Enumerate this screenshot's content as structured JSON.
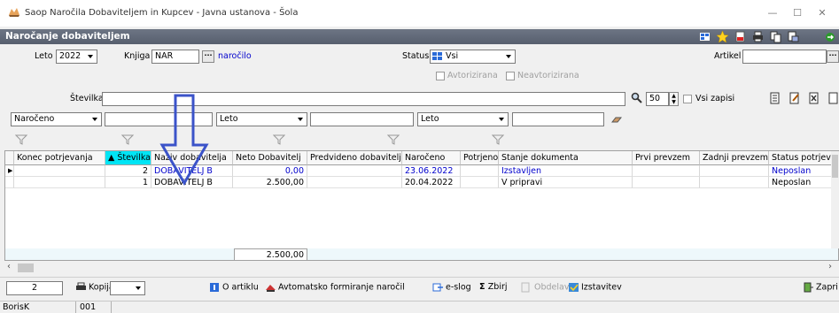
{
  "window": {
    "title": "Saop  Naročila Dobaviteljem in Kupcev - Javna ustanova - Šola"
  },
  "header": {
    "title": "Naročanje dobaviteljem"
  },
  "form": {
    "leto_label": "Leto",
    "leto_value": "2022",
    "knjiga_label": "Knjiga",
    "knjiga_value": "NAR",
    "knjiga_link": "naročilo",
    "status_label": "Status",
    "status_value": "Vsi",
    "artikel_label": "Artikel",
    "avtorizirana": "Avtorizirana",
    "neavtorizirana": "Neavtorizirana",
    "stevilka_label": "Številka",
    "limit_value": "50",
    "vsi_zapisi": "Vsi zapisi",
    "filter1": "Naročeno",
    "filter2": "Leto",
    "filter3": "Leto"
  },
  "grid": {
    "columns": [
      "Konec potrjevanja",
      "▲ Številka",
      "Naziv dobavitelja",
      "Neto Dobavitelj",
      "Predvideno dobavitelj",
      "Naročeno",
      "Potrjeno",
      "Stanje dokumenta",
      "Prvi prevzem",
      "Zadnji prevzem",
      "Status potrjevanja"
    ],
    "rows": [
      {
        "stevilka": "2",
        "naziv": "DOBAVITELJ  B",
        "neto": "0,00",
        "naroceno": "23.06.2022",
        "stanje": "Izstavljen",
        "status": "Neposlan"
      },
      {
        "stevilka": "1",
        "naziv": "DOBAVITELJ  B",
        "neto": "2.500,00",
        "naroceno": "20.04.2022",
        "stanje": "V pripravi",
        "status": "Neposlan"
      }
    ],
    "total": "2.500,00"
  },
  "toolbar": {
    "count": "2",
    "kopija": "Kopija",
    "o_artiklu": "O artiklu",
    "avtomatsko": "Avtomatsko formiranje naročil",
    "eslog": "e-slog",
    "zbirj": "Zbirj",
    "obdelave": "Obdelave",
    "izstavitev": "Izstavitev",
    "zapri": "Zapri"
  },
  "status": {
    "user": "BorisK",
    "code": "001"
  }
}
